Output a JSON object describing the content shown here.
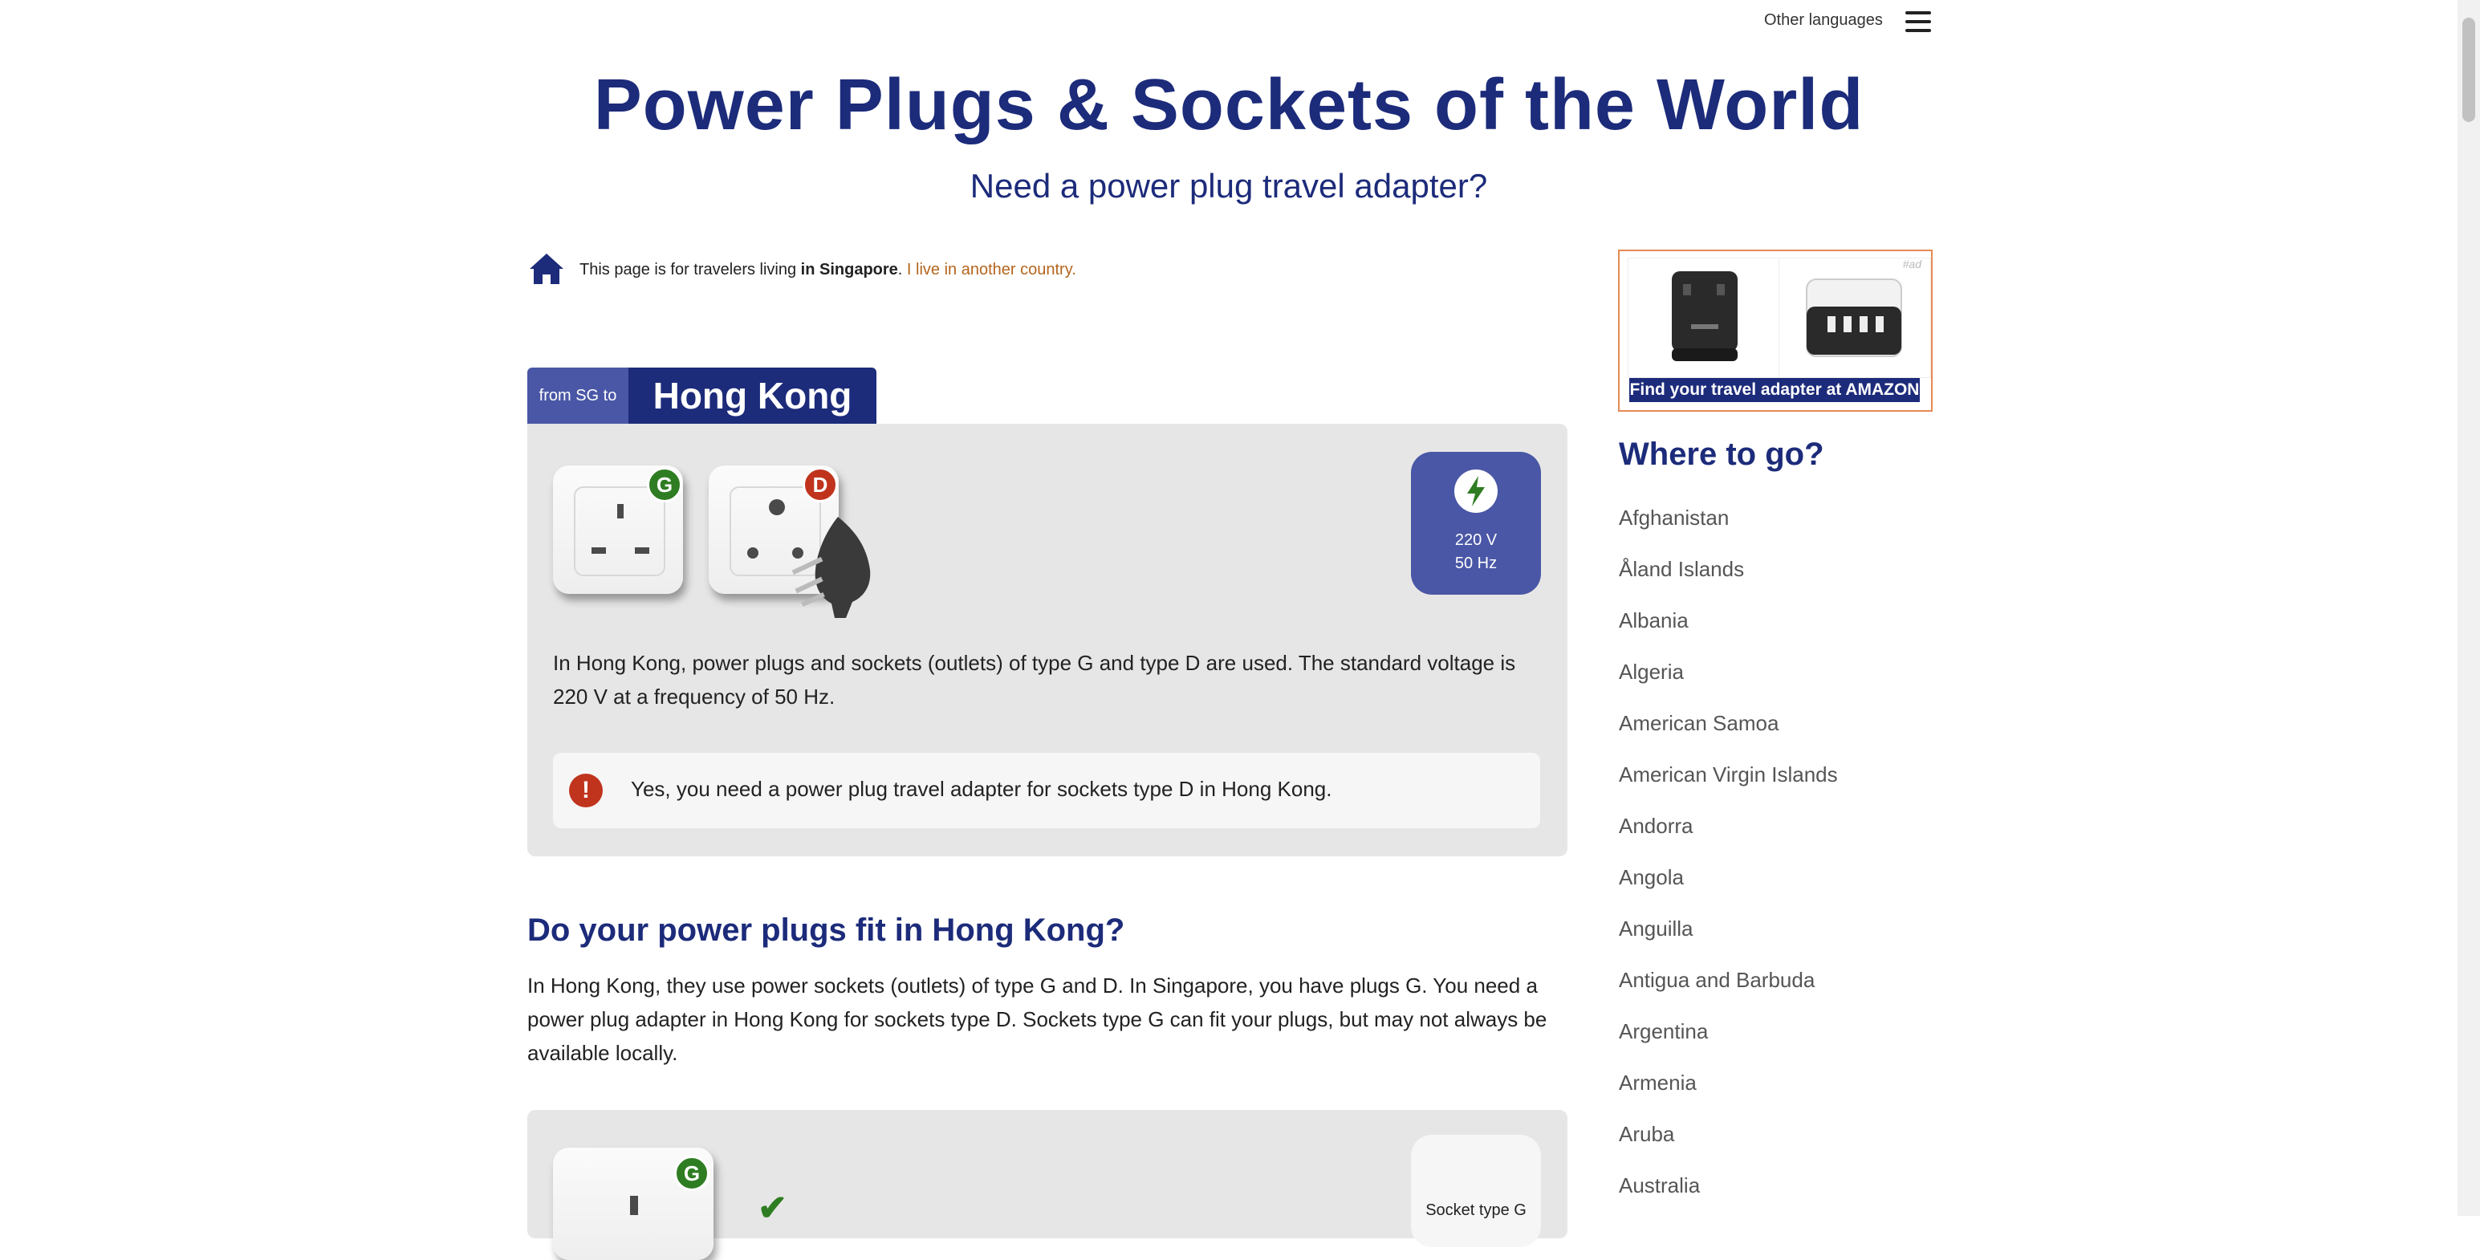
{
  "header": {
    "other_languages": "Other languages",
    "title": "Power Plugs & Sockets of the World",
    "subtitle": "Need a power plug travel adapter?"
  },
  "traveler": {
    "prefix": "This page is for travelers living ",
    "country": "in Singapore",
    "suffix": ". ",
    "link": "I live in another country."
  },
  "destination": {
    "from_label": "from SG to",
    "country": "Hong Kong",
    "sockets": [
      {
        "type": "G",
        "color": "#2f7d22"
      },
      {
        "type": "D",
        "color": "#c0341d"
      }
    ],
    "voltage": "220 V",
    "frequency": "50 Hz",
    "description": "In Hong Kong, power plugs and sockets (outlets) of type G and type D are used. The standard voltage is 220 V at a frequency of 50 Hz.",
    "notice": "Yes, you need a power plug travel adapter for sockets type D in Hong Kong."
  },
  "section_fit": {
    "heading": "Do your power plugs fit in Hong Kong?",
    "body": "In Hong Kong, they use power sockets (outlets) of type G and D. In Singapore, you have plugs G. You need a power plug adapter in Hong Kong for sockets type D. Sockets type G can fit your plugs, but may not always be available locally.",
    "socket_badge": "G",
    "socket_label": "Socket type G"
  },
  "ad": {
    "label": "Find your travel adapter at AMAZON",
    "tag": "#ad"
  },
  "sidebar": {
    "heading": "Where to go?",
    "countries": [
      "Afghanistan",
      "Åland Islands",
      "Albania",
      "Algeria",
      "American Samoa",
      "American Virgin Islands",
      "Andorra",
      "Angola",
      "Anguilla",
      "Antigua and Barbuda",
      "Argentina",
      "Armenia",
      "Aruba",
      "Australia"
    ]
  },
  "colors": {
    "brand_navy": "#1c2b7a",
    "brand_blue": "#4a57a6",
    "link_orange": "#b5651d",
    "ok_green": "#2f7d22",
    "warn_red": "#c0341d"
  }
}
